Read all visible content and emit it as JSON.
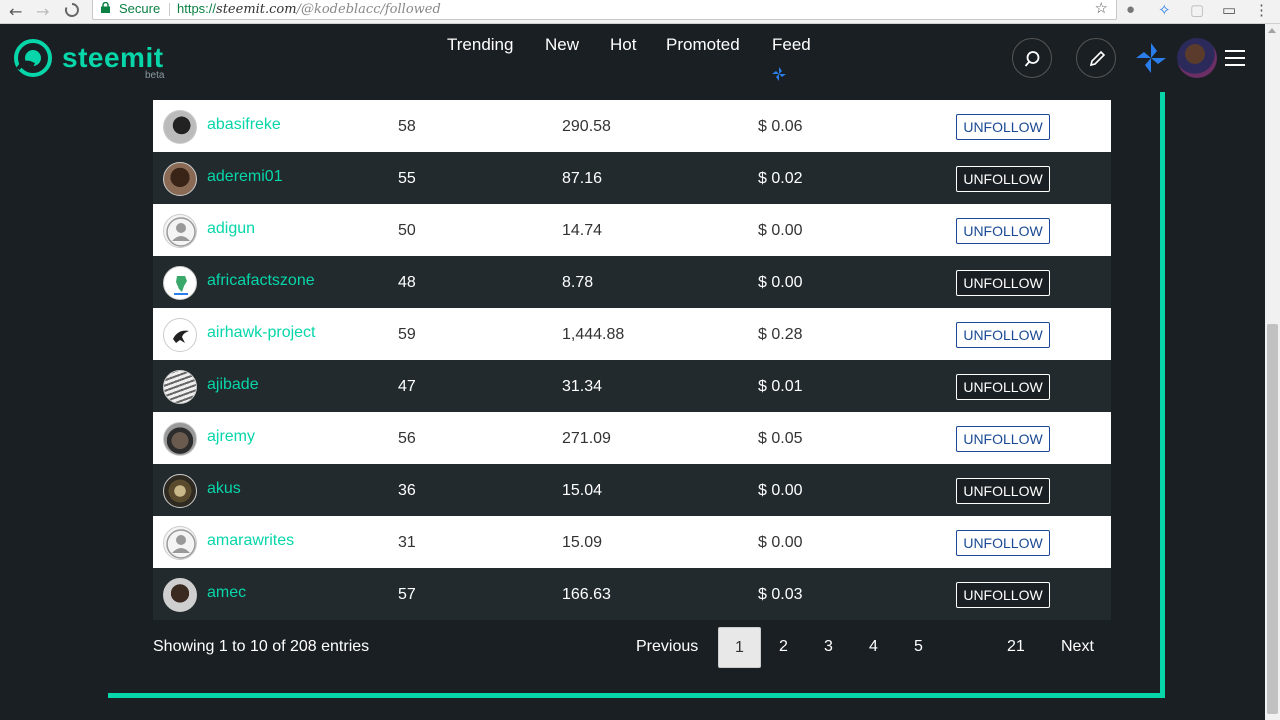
{
  "browser": {
    "secure_label": "Secure",
    "url_proto": "https://",
    "url_host": "steemit.com",
    "url_path": "/@kodeblacc/followed"
  },
  "header": {
    "logo_text": "steemit",
    "logo_beta": "beta",
    "nav": [
      "Trending",
      "New",
      "Hot",
      "Promoted",
      "Feed"
    ]
  },
  "colors": {
    "accent": "#06d6a9",
    "background": "#1a1f23",
    "row_dark": "#222a2e",
    "link_blue": "#1a4a94"
  },
  "table": {
    "rows": [
      {
        "name": "abasifreke",
        "reputation": "58",
        "steem_power": "290.58",
        "vote_value": "$ 0.06",
        "action": "UNFOLLOW",
        "avatar": "dark-portrait"
      },
      {
        "name": "aderemi01",
        "reputation": "55",
        "steem_power": "87.16",
        "vote_value": "$ 0.02",
        "action": "UNFOLLOW",
        "avatar": "brown-portrait"
      },
      {
        "name": "adigun",
        "reputation": "50",
        "steem_power": "14.74",
        "vote_value": "$ 0.00",
        "action": "UNFOLLOW",
        "avatar": "default-user"
      },
      {
        "name": "africafactszone",
        "reputation": "48",
        "steem_power": "8.78",
        "vote_value": "$ 0.00",
        "action": "UNFOLLOW",
        "avatar": "africa-map"
      },
      {
        "name": "airhawk-project",
        "reputation": "59",
        "steem_power": "1,444.88",
        "vote_value": "$ 0.28",
        "action": "UNFOLLOW",
        "avatar": "hawk-logo"
      },
      {
        "name": "ajibade",
        "reputation": "47",
        "steem_power": "31.34",
        "vote_value": "$ 0.01",
        "action": "UNFOLLOW",
        "avatar": "sketch-portrait"
      },
      {
        "name": "ajremy",
        "reputation": "56",
        "steem_power": "271.09",
        "vote_value": "$ 0.05",
        "action": "UNFOLLOW",
        "avatar": "cap-portrait"
      },
      {
        "name": "akus",
        "reputation": "36",
        "steem_power": "15.04",
        "vote_value": "$ 0.00",
        "action": "UNFOLLOW",
        "avatar": "outdoor-portrait"
      },
      {
        "name": "amarawrites",
        "reputation": "31",
        "steem_power": "15.09",
        "vote_value": "$ 0.00",
        "action": "UNFOLLOW",
        "avatar": "default-user"
      },
      {
        "name": "amec",
        "reputation": "57",
        "steem_power": "166.63",
        "vote_value": "$ 0.03",
        "action": "UNFOLLOW",
        "avatar": "face-portrait"
      }
    ]
  },
  "footer": {
    "entries": "Showing 1 to 10 of 208 entries",
    "previous": "Previous",
    "pages": [
      "1",
      "2",
      "3",
      "4",
      "5"
    ],
    "last_page": "21",
    "next": "Next",
    "current_page": "1"
  }
}
